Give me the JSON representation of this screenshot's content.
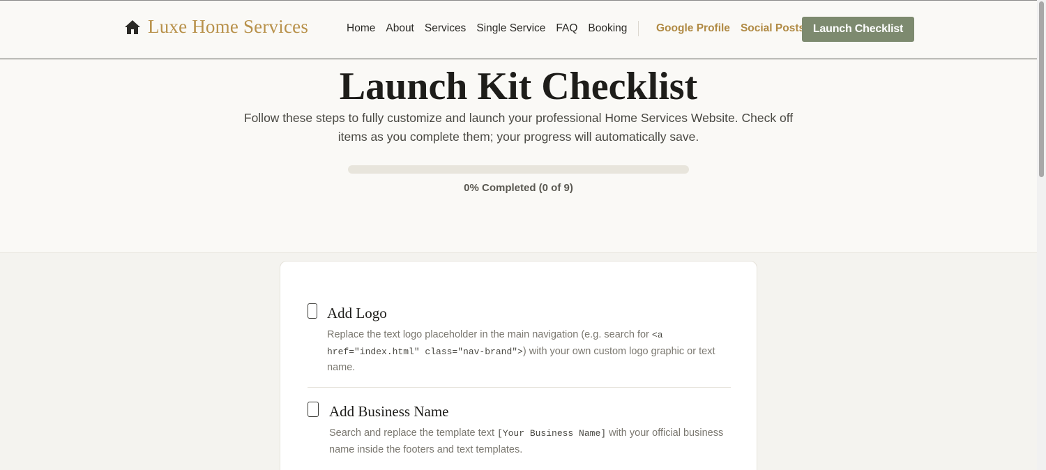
{
  "nav": {
    "brand": "Luxe Home Services",
    "links": [
      "Home",
      "About",
      "Services",
      "Single Service",
      "FAQ",
      "Booking"
    ],
    "alt_links": [
      "Google Profile",
      "Social Posts"
    ],
    "cta": "Launch Checklist"
  },
  "hero": {
    "title": "Launch Kit Checklist",
    "description": "Follow these steps to fully customize and launch your professional Home Services Website. Check off items as you complete them; your progress will automatically save.",
    "progress_percent": 0,
    "progress_label": "0% Completed (0 of 9)"
  },
  "items": [
    {
      "title": "Add Logo",
      "desc_before": "Replace the text logo placeholder in the main navigation (e.g. search for ",
      "desc_code": "<a href=\"index.html\" class=\"nav-brand\">",
      "desc_after": ") with your own custom logo graphic or text name.",
      "checked": false
    },
    {
      "title": "Add Business Name",
      "desc_before": "Search and replace the template text ",
      "desc_code": "[Your Business Name]",
      "desc_after": " with your official business name inside the footers and text templates.",
      "checked": false
    }
  ],
  "colors": {
    "brand": "#b8914a",
    "accent": "#7d8a6f",
    "background": "#faf9f6"
  }
}
